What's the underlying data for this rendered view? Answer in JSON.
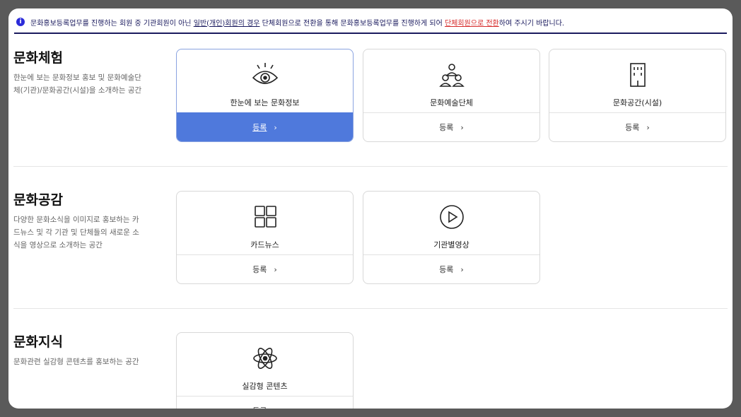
{
  "notice": {
    "part1": "문화홍보등록업무를 진행하는 회원 중 기관회원이 아닌",
    "part2": "일반(개인)회원의 경우",
    "part3": "단체회원으로 전환을 통해 문화홍보등록업무를 진행하게 되어",
    "part4": "단체회원으로 전환",
    "part5": "하여 주시기 바랍니다.",
    "info_symbol": "i"
  },
  "sections": [
    {
      "title": "문화체험",
      "desc": "한눈에 보는 문화정보 홍보 및  문화예술단체(기관)/문화공간(시설)을 소개하는 공간",
      "cards": [
        {
          "label": "한눈에 보는 문화정보",
          "icon": "eye-icon",
          "action": "등록",
          "active": true
        },
        {
          "label": "문화예술단체",
          "icon": "group-icon",
          "action": "등록"
        },
        {
          "label": "문화공간(시설)",
          "icon": "building-icon",
          "action": "등록"
        }
      ]
    },
    {
      "title": "문화공감",
      "desc": "다양한 문화소식을 이미지로 홍보하는 카드뉴스 및 각 기관 및 단체들의 새로운 소식을 영상으로 소개하는 공간",
      "cards": [
        {
          "label": "카드뉴스",
          "icon": "grid-icon",
          "action": "등록"
        },
        {
          "label": "기관별영상",
          "icon": "play-icon",
          "action": "등록"
        }
      ]
    },
    {
      "title": "문화지식",
      "desc": "문화관련 실감형 콘텐츠를 홍보하는 공간",
      "cards": [
        {
          "label": "실감형 콘텐츠",
          "icon": "atom-icon",
          "action": "등록"
        }
      ]
    }
  ],
  "chevron": "›",
  "colors": {
    "accent": "#4f79dc",
    "notice_text": "#1a1a5e",
    "notice_red": "#d62b2b"
  }
}
